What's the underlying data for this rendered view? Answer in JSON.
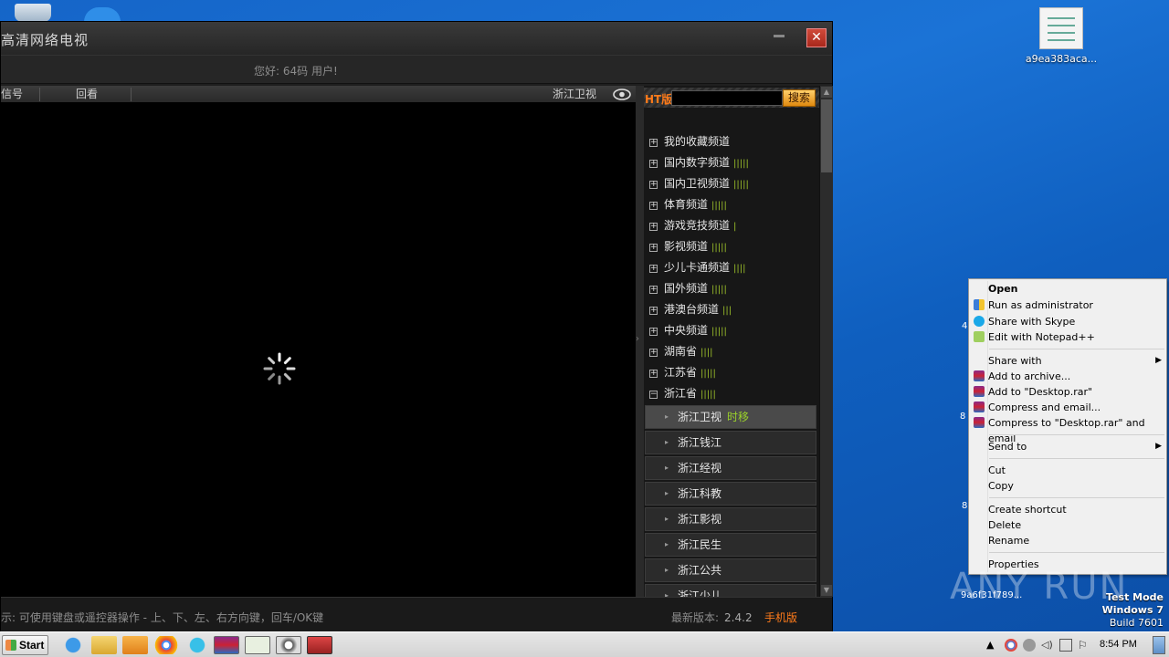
{
  "app": {
    "title": "高清网络电视",
    "greeting": "您好: 64码 用户!",
    "close_glyph": "✕",
    "tabs": [
      "信号",
      "回看"
    ],
    "current_channel": "浙江卫视",
    "panel": {
      "ht_label": "HT版",
      "search_placeholder": "",
      "search_button": "搜索",
      "categories": [
        {
          "label": "我的收藏频道",
          "signal": "",
          "expanded": false
        },
        {
          "label": "国内数字频道",
          "signal": "|||||",
          "expanded": false
        },
        {
          "label": "国内卫视频道",
          "signal": "|||||",
          "expanded": false
        },
        {
          "label": "体育频道",
          "signal": "|||||",
          "expanded": false
        },
        {
          "label": "游戏竞技频道",
          "signal": "|",
          "expanded": false
        },
        {
          "label": "影视频道",
          "signal": "|||||",
          "expanded": false
        },
        {
          "label": "少儿卡通频道",
          "signal": "||||",
          "expanded": false
        },
        {
          "label": "国外频道",
          "signal": "|||||",
          "expanded": false
        },
        {
          "label": "港澳台频道",
          "signal": "|||",
          "expanded": false
        },
        {
          "label": "中央频道",
          "signal": "|||||",
          "expanded": false
        },
        {
          "label": "湖南省",
          "signal": "||||",
          "expanded": false
        },
        {
          "label": "江苏省",
          "signal": "|||||",
          "expanded": false
        },
        {
          "label": "浙江省",
          "signal": "|||||",
          "expanded": true
        }
      ],
      "box_collapsed": "+",
      "box_expanded": "−",
      "subchannels": [
        {
          "label": "浙江卫视",
          "tag": "时移",
          "active": true
        },
        {
          "label": "浙江钱江",
          "tag": "",
          "active": false
        },
        {
          "label": "浙江经视",
          "tag": "",
          "active": false
        },
        {
          "label": "浙江科教",
          "tag": "",
          "active": false
        },
        {
          "label": "浙江影视",
          "tag": "",
          "active": false
        },
        {
          "label": "浙江民生",
          "tag": "",
          "active": false
        },
        {
          "label": "浙江公共",
          "tag": "",
          "active": false
        },
        {
          "label": "浙江少儿",
          "tag": "",
          "active": false
        }
      ]
    },
    "status": {
      "hint": "示: 可使用键盘或遥控器操作 - 上、下、左、右方向键，回车/OK键",
      "version_label": "最新版本:",
      "version_value": "2.4.2",
      "mobile": "手机版"
    }
  },
  "desktop": {
    "file_label": "a9ea383aca...",
    "frag_1": "4",
    "frag_2": "8",
    "frag_3": "8",
    "frag_4": "9a6f31f789...",
    "watermark": "ANY RUN",
    "test_mode": [
      "Test Mode",
      "Windows 7",
      "Build 7601"
    ]
  },
  "context_menu": {
    "items": [
      {
        "label": "Open",
        "bold": true
      },
      {
        "label": "Run as administrator",
        "icon": "shield-icon"
      },
      {
        "label": "Share with Skype",
        "icon": "skype-icon"
      },
      {
        "label": "Edit with Notepad++",
        "icon": "notepad-icon"
      },
      {
        "label": "Share with",
        "submenu": true
      },
      {
        "label": "Add to archive...",
        "icon": "winrar-icon"
      },
      {
        "label": "Add to \"Desktop.rar\"",
        "icon": "winrar-icon"
      },
      {
        "label": "Compress and email...",
        "icon": "winrar-icon"
      },
      {
        "label": "Compress to \"Desktop.rar\" and email",
        "icon": "winrar-icon"
      },
      {
        "label": "Send to",
        "submenu": true
      },
      {
        "label": "Cut"
      },
      {
        "label": "Copy"
      },
      {
        "label": "Create shortcut"
      },
      {
        "label": "Delete"
      },
      {
        "label": "Rename"
      },
      {
        "label": "Properties"
      }
    ],
    "submenu_glyph": "▶"
  },
  "taskbar": {
    "start_label": "Start",
    "clock": "8:54 PM"
  },
  "colors": {
    "accent_orange": "#ff7b1a",
    "signal_green": "#9bbf2a",
    "desktop_blue": "#1565c8"
  }
}
